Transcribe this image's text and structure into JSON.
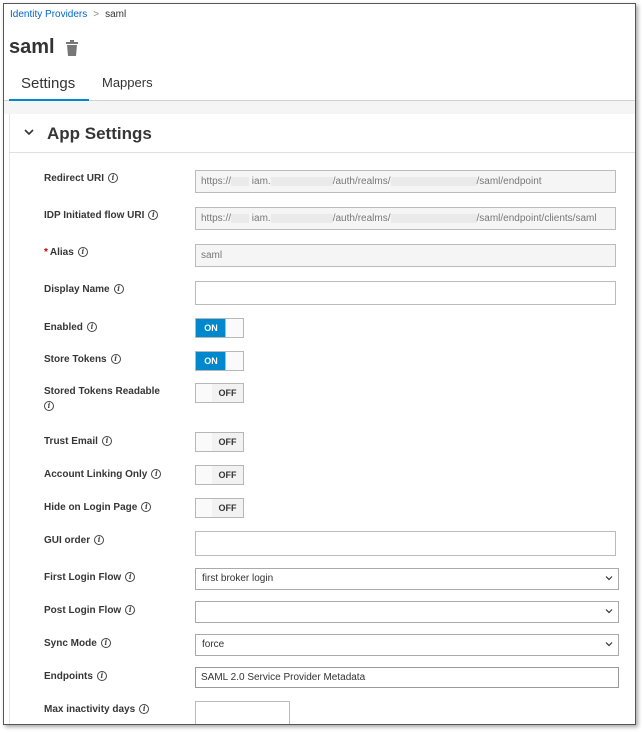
{
  "breadcrumb": {
    "parent": "Identity Providers",
    "separator": ">",
    "current": "saml"
  },
  "page": {
    "title": "saml"
  },
  "tabs": [
    {
      "label": "Settings"
    },
    {
      "label": "Mappers"
    }
  ],
  "section": {
    "title": "App Settings"
  },
  "form": {
    "redirect_uri": {
      "label": "Redirect URI",
      "p1": "https://",
      "p2": "iam.",
      "p3": "/auth/realms/",
      "p4": "/saml/endpoint"
    },
    "idp_flow_uri": {
      "label": "IDP Initiated flow URI",
      "p1": "https://",
      "p2": "iam.",
      "p3": "/auth/realms/",
      "p4": "/saml/endpoint/clients/saml"
    },
    "alias": {
      "label": "Alias",
      "required": "*",
      "value": "saml"
    },
    "display_name": {
      "label": "Display Name",
      "value": ""
    },
    "enabled": {
      "label": "Enabled",
      "state": "ON"
    },
    "store_tokens": {
      "label": "Store Tokens",
      "state": "ON"
    },
    "stored_tokens_readable": {
      "label": "Stored Tokens Readable",
      "state": "OFF"
    },
    "trust_email": {
      "label": "Trust Email",
      "state": "OFF"
    },
    "account_linking_only": {
      "label": "Account Linking Only",
      "state": "OFF"
    },
    "hide_on_login_page": {
      "label": "Hide on Login Page",
      "state": "OFF"
    },
    "gui_order": {
      "label": "GUI order",
      "value": ""
    },
    "first_login_flow": {
      "label": "First Login Flow",
      "value": "first broker login"
    },
    "post_login_flow": {
      "label": "Post Login Flow",
      "value": ""
    },
    "sync_mode": {
      "label": "Sync Mode",
      "value": "force"
    },
    "endpoints": {
      "label": "Endpoints",
      "value": "SAML 2.0 Service Provider Metadata"
    },
    "max_inactivity_days": {
      "label": "Max inactivity days",
      "value": ""
    }
  },
  "icons": {
    "info": "info-icon",
    "trash": "trash-icon",
    "chevron": "chevron-down-icon"
  },
  "colors": {
    "accent": "#0088ce",
    "link": "#0066cc",
    "required": "#cc0000"
  }
}
